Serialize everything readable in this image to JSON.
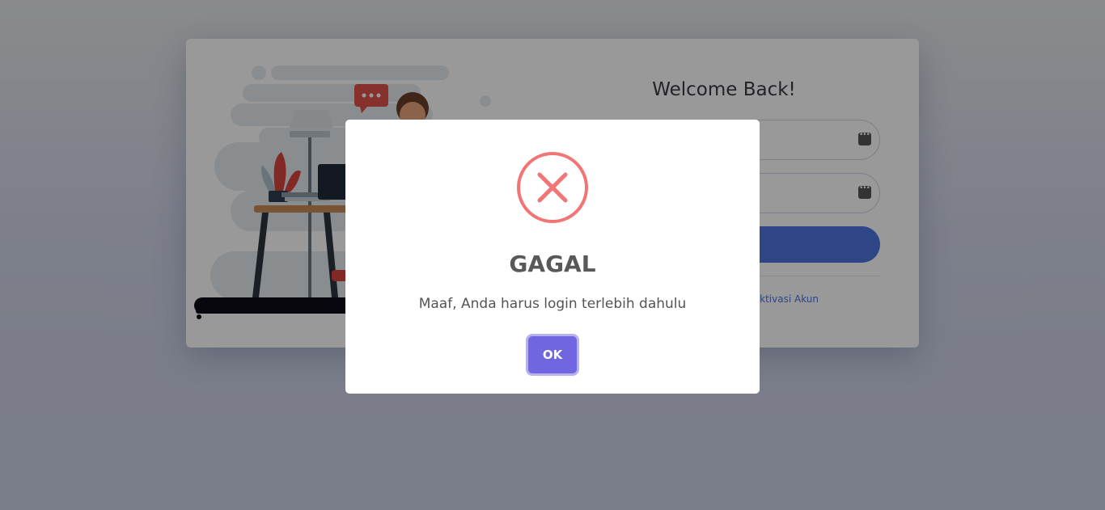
{
  "login": {
    "welcome": "Welcome Back!",
    "link_aktivasi": "Aktivasi Akun"
  },
  "dialog": {
    "icon": "error-x-icon",
    "title": "GAGAL",
    "message": "Maaf, Anda harus login terlebih dahulu",
    "ok_label": "OK"
  },
  "colors": {
    "primary": "#4e73df",
    "error": "#f27474",
    "confirm": "#7066e0"
  }
}
